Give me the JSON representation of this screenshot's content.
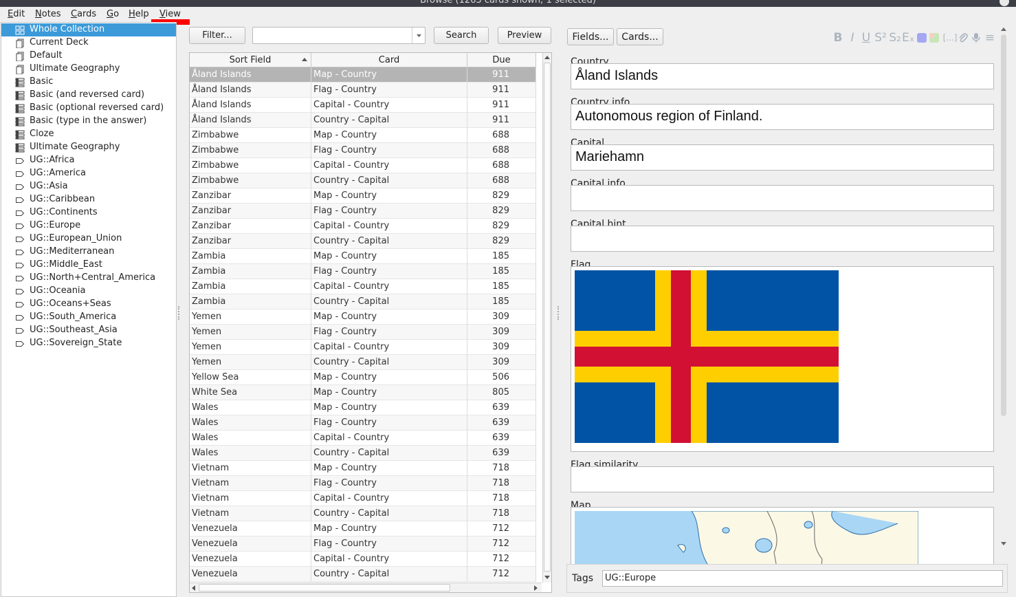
{
  "window": {
    "title": "Browse (1263 cards shown; 1 selected)"
  },
  "menu": [
    {
      "label": "Edit"
    },
    {
      "label": "Notes"
    },
    {
      "label": "Cards"
    },
    {
      "label": "Go"
    },
    {
      "label": "Help"
    },
    {
      "label": "View"
    }
  ],
  "sidebar": {
    "items": [
      {
        "label": "Whole Collection",
        "icon": "collection-icon",
        "selected": true
      },
      {
        "label": "Current Deck",
        "icon": "deck-icon"
      },
      {
        "label": "Default",
        "icon": "deck-icon"
      },
      {
        "label": "Ultimate Geography",
        "icon": "deck-icon"
      },
      {
        "label": "Basic",
        "icon": "notetype-icon"
      },
      {
        "label": "Basic (and reversed card)",
        "icon": "notetype-icon"
      },
      {
        "label": "Basic (optional reversed card)",
        "icon": "notetype-icon"
      },
      {
        "label": "Basic (type in the answer)",
        "icon": "notetype-icon"
      },
      {
        "label": "Cloze",
        "icon": "notetype-icon"
      },
      {
        "label": "Ultimate Geography",
        "icon": "notetype-icon"
      },
      {
        "label": "UG::Africa",
        "icon": "tag-icon"
      },
      {
        "label": "UG::America",
        "icon": "tag-icon"
      },
      {
        "label": "UG::Asia",
        "icon": "tag-icon"
      },
      {
        "label": "UG::Caribbean",
        "icon": "tag-icon"
      },
      {
        "label": "UG::Continents",
        "icon": "tag-icon"
      },
      {
        "label": "UG::Europe",
        "icon": "tag-icon"
      },
      {
        "label": "UG::European_Union",
        "icon": "tag-icon"
      },
      {
        "label": "UG::Mediterranean",
        "icon": "tag-icon"
      },
      {
        "label": "UG::Middle_East",
        "icon": "tag-icon"
      },
      {
        "label": "UG::North+Central_America",
        "icon": "tag-icon"
      },
      {
        "label": "UG::Oceania",
        "icon": "tag-icon"
      },
      {
        "label": "UG::Oceans+Seas",
        "icon": "tag-icon"
      },
      {
        "label": "UG::South_America",
        "icon": "tag-icon"
      },
      {
        "label": "UG::Southeast_Asia",
        "icon": "tag-icon"
      },
      {
        "label": "UG::Sovereign_State",
        "icon": "tag-icon"
      }
    ]
  },
  "toolbar": {
    "filter_label": "Filter...",
    "search_value": "",
    "search_label": "Search",
    "preview_label": "Preview"
  },
  "table": {
    "columns": [
      {
        "label": "Sort Field",
        "sorted": "asc"
      },
      {
        "label": "Card"
      },
      {
        "label": "Due"
      }
    ],
    "rows": [
      {
        "sort": "Åland Islands",
        "card": "Map - Country",
        "due": "911",
        "selected": true
      },
      {
        "sort": "Åland Islands",
        "card": "Flag - Country",
        "due": "911"
      },
      {
        "sort": "Åland Islands",
        "card": "Capital - Country",
        "due": "911"
      },
      {
        "sort": "Åland Islands",
        "card": "Country - Capital",
        "due": "911"
      },
      {
        "sort": "Zimbabwe",
        "card": "Map - Country",
        "due": "688"
      },
      {
        "sort": "Zimbabwe",
        "card": "Flag - Country",
        "due": "688"
      },
      {
        "sort": "Zimbabwe",
        "card": "Capital - Country",
        "due": "688"
      },
      {
        "sort": "Zimbabwe",
        "card": "Country - Capital",
        "due": "688"
      },
      {
        "sort": "Zanzibar",
        "card": "Map - Country",
        "due": "829"
      },
      {
        "sort": "Zanzibar",
        "card": "Flag - Country",
        "due": "829"
      },
      {
        "sort": "Zanzibar",
        "card": "Capital - Country",
        "due": "829"
      },
      {
        "sort": "Zanzibar",
        "card": "Country - Capital",
        "due": "829"
      },
      {
        "sort": "Zambia",
        "card": "Map - Country",
        "due": "185"
      },
      {
        "sort": "Zambia",
        "card": "Flag - Country",
        "due": "185"
      },
      {
        "sort": "Zambia",
        "card": "Capital - Country",
        "due": "185"
      },
      {
        "sort": "Zambia",
        "card": "Country - Capital",
        "due": "185"
      },
      {
        "sort": "Yemen",
        "card": "Map - Country",
        "due": "309"
      },
      {
        "sort": "Yemen",
        "card": "Flag - Country",
        "due": "309"
      },
      {
        "sort": "Yemen",
        "card": "Capital - Country",
        "due": "309"
      },
      {
        "sort": "Yemen",
        "card": "Country - Capital",
        "due": "309"
      },
      {
        "sort": "Yellow Sea",
        "card": "Map - Country",
        "due": "506"
      },
      {
        "sort": "White Sea",
        "card": "Map - Country",
        "due": "805"
      },
      {
        "sort": "Wales",
        "card": "Map - Country",
        "due": "639"
      },
      {
        "sort": "Wales",
        "card": "Flag - Country",
        "due": "639"
      },
      {
        "sort": "Wales",
        "card": "Capital - Country",
        "due": "639"
      },
      {
        "sort": "Wales",
        "card": "Country - Capital",
        "due": "639"
      },
      {
        "sort": "Vietnam",
        "card": "Map - Country",
        "due": "718"
      },
      {
        "sort": "Vietnam",
        "card": "Flag - Country",
        "due": "718"
      },
      {
        "sort": "Vietnam",
        "card": "Capital - Country",
        "due": "718"
      },
      {
        "sort": "Vietnam",
        "card": "Country - Capital",
        "due": "718"
      },
      {
        "sort": "Venezuela",
        "card": "Map - Country",
        "due": "712"
      },
      {
        "sort": "Venezuela",
        "card": "Flag - Country",
        "due": "712"
      },
      {
        "sort": "Venezuela",
        "card": "Capital - Country",
        "due": "712"
      },
      {
        "sort": "Venezuela",
        "card": "Country - Capital",
        "due": "712"
      }
    ]
  },
  "editor": {
    "fields_label": "Fields...",
    "cards_label": "Cards...",
    "format_buttons": [
      {
        "glyph": "B",
        "icon": "bold-icon"
      },
      {
        "glyph": "I",
        "icon": "italic-icon"
      },
      {
        "glyph": "U",
        "icon": "underline-icon"
      },
      {
        "glyph": "S²",
        "icon": "superscript-icon"
      },
      {
        "glyph": "S₂",
        "icon": "subscript-icon"
      },
      {
        "glyph": "Eₓ",
        "icon": "clear-format-icon"
      },
      {
        "glyph": "",
        "icon": "text-color-icon"
      },
      {
        "glyph": "",
        "icon": "highlight-icon"
      },
      {
        "glyph": "[...]",
        "icon": "cloze-icon"
      },
      {
        "glyph": "",
        "icon": "attach-icon"
      },
      {
        "glyph": "",
        "icon": "record-icon"
      },
      {
        "glyph": "≡",
        "icon": "more-icon"
      }
    ],
    "fields": [
      {
        "label": "Country",
        "value": "Åland Islands"
      },
      {
        "label": "Country info",
        "value": "Autonomous region of Finland."
      },
      {
        "label": "Capital",
        "value": "Mariehamn"
      },
      {
        "label": "Capital info",
        "value": ""
      },
      {
        "label": "Capital hint",
        "value": ""
      },
      {
        "label": "Flag",
        "value": "",
        "image": "aland-flag"
      },
      {
        "label": "Flag similarity",
        "value": ""
      },
      {
        "label": "Map",
        "value": "",
        "image": "aland-map"
      }
    ],
    "colors": {
      "flag_blue": "#0053a5",
      "flag_yellow": "#ffce00",
      "flag_red": "#d21034",
      "map_sea": "#a9d6f5",
      "map_land": "#fbf8e6"
    },
    "tags_label": "Tags",
    "tags_value": "UG::Europe"
  }
}
